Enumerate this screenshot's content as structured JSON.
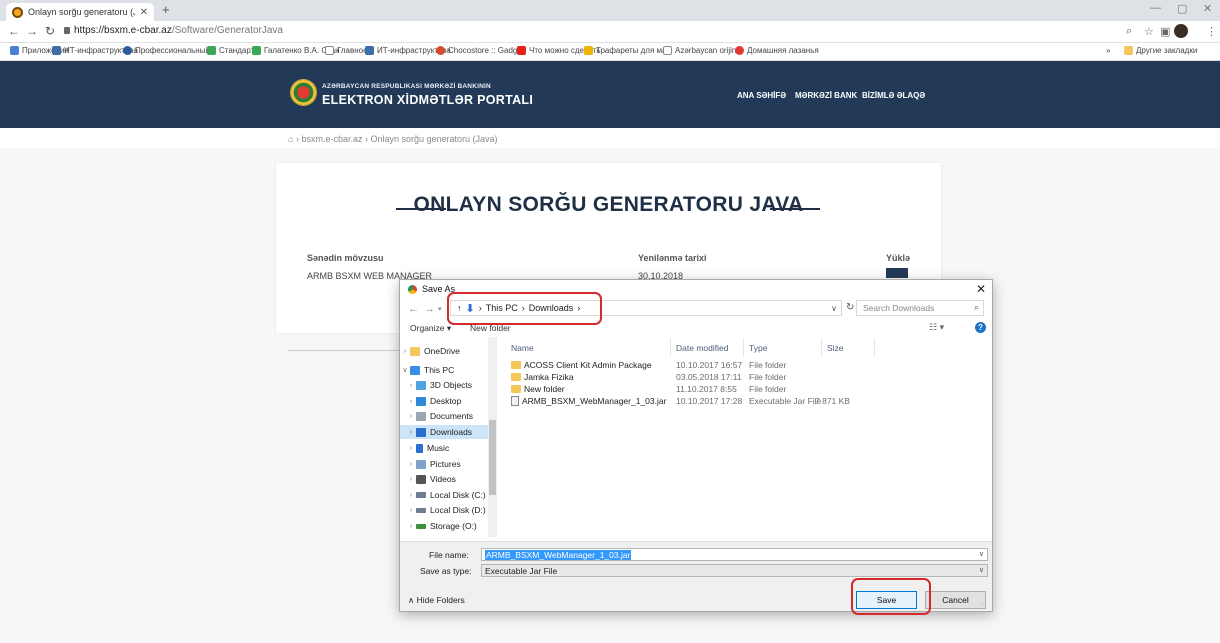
{
  "browser": {
    "tab_title": "Onlayn sorğu generatoru (Java)",
    "url_host": "https://bsxm.e-cbar.az",
    "url_path": "/Software/GeneratorJava",
    "bookmarks": [
      "Приложения",
      "ИТ-инфраструктура",
      "Профессиональный",
      "Стандарты",
      "Галатенко В.А. Стан",
      "Главное",
      "ИТ-инфраструктура",
      "Chocostore :: Gadge",
      "Что можно сделать",
      "Трафареты для мат",
      "Azərbaycan orijinal",
      "Домашняя лазанья"
    ],
    "other_bookmarks": "Другие закладки"
  },
  "site": {
    "bank_name": "AZƏRBAYCAN RESPUBLIKASI MƏRKƏZİ BANKININ",
    "portal_name": "ELEKTRON XİDMƏTLƏR PORTALI",
    "nav": [
      "ANA SƏHİFƏ",
      "MƏRKƏZİ BANK",
      "BİZİMLƏ ƏLAQƏ"
    ],
    "breadcrumb": [
      "bsxm.e-cbar.az",
      "Onlayn sorğu generatoru (Java)"
    ]
  },
  "card": {
    "title": "ONLAYN SORĞU GENERATORU JAVA",
    "col_subject": "Sənədin mövzusu",
    "col_updated": "Yenilənmə tarixi",
    "col_download": "Yüklə",
    "row_subject": "ARMB BSXM WEB MANAGER",
    "row_updated": "30.10.2018"
  },
  "dialog": {
    "title": "Save As",
    "path": [
      "This PC",
      "Downloads"
    ],
    "search_placeholder": "Search Downloads",
    "organize": "Organize ▾",
    "new_folder": "New folder",
    "tree": [
      {
        "label": "OneDrive",
        "color": "#f3c759"
      },
      {
        "label": "This PC",
        "color": "#3a8ee6"
      },
      {
        "label": "3D Objects",
        "color": "#4fa3e0"
      },
      {
        "label": "Desktop",
        "color": "#2f8ad8"
      },
      {
        "label": "Documents",
        "color": "#9aa6b2"
      },
      {
        "label": "Downloads",
        "color": "#2a6fd0"
      },
      {
        "label": "Music",
        "color": "#2a6fd0"
      },
      {
        "label": "Pictures",
        "color": "#7fa3c8"
      },
      {
        "label": "Videos",
        "color": "#555555"
      },
      {
        "label": "Local Disk (C:)",
        "color": "#6b7d8f"
      },
      {
        "label": "Local Disk (D:)",
        "color": "#6b7d8f"
      },
      {
        "label": "Storage (O:)",
        "color": "#3d8f3d"
      }
    ],
    "columns": [
      "Name",
      "Date modified",
      "Type",
      "Size"
    ],
    "files": [
      {
        "name": "ACOSS Client Kit Admin Package",
        "date": "10.10.2017 16:57",
        "type": "File folder",
        "size": "",
        "kind": "folder"
      },
      {
        "name": "Jamka Fizika",
        "date": "03.05.2018 17:11",
        "type": "File folder",
        "size": "",
        "kind": "folder"
      },
      {
        "name": "New folder",
        "date": "11.10.2017 8:55",
        "type": "File folder",
        "size": "",
        "kind": "folder"
      },
      {
        "name": "ARMB_BSXM_WebManager_1_03.jar",
        "date": "10.10.2017 17:28",
        "type": "Executable Jar File",
        "size": "7 871 KB",
        "kind": "jar"
      }
    ],
    "file_name_label": "File name:",
    "file_name_value": "ARMB_BSXM_WebManager_1_03.jar",
    "save_type_label": "Save as type:",
    "save_type_value": "Executable Jar File",
    "hide_folders": "Hide Folders",
    "save_label": "Save",
    "cancel_label": "Cancel"
  },
  "colors": {
    "header_bg": "#223a57",
    "annotation": "#d42a2a",
    "selection": "#3399ff"
  }
}
